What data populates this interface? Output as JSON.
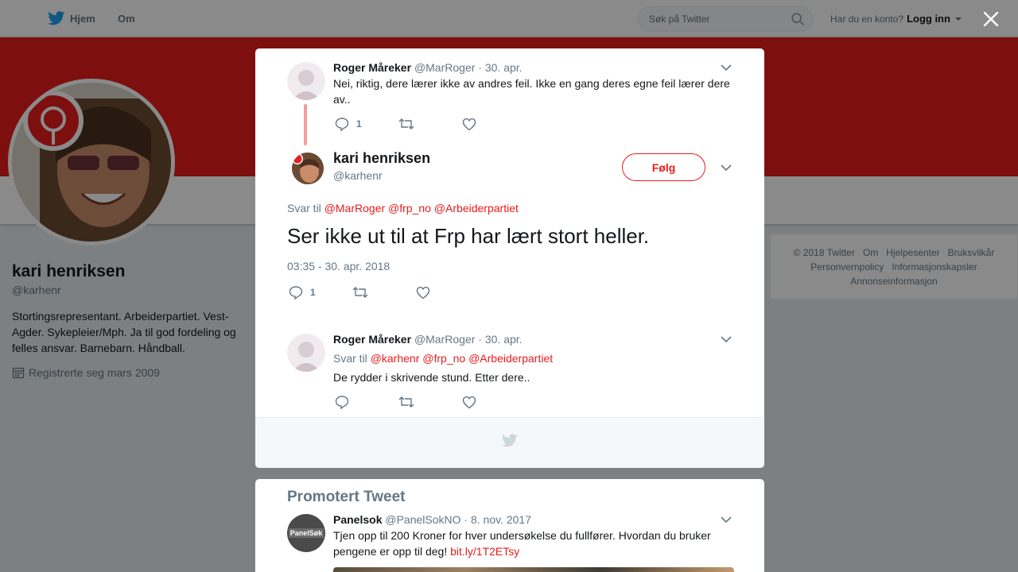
{
  "topbar": {
    "home_label": "Hjem",
    "about_label": "Om",
    "search_placeholder": "Søk på Twitter",
    "account_question": "Har du en konto?",
    "login_label": "Logg inn"
  },
  "profile": {
    "name": "kari henriksen",
    "handle": "@karhenr",
    "bio": "Stortingsrepresentant. Arbeiderpartiet. Vest-Agder. Sykepleier/Mph. Ja til god fordeling og felles ansvar. Barnebarn. Håndball.",
    "joined": "Registrerte seg mars 2009"
  },
  "footer_links": [
    "© 2018 Twitter",
    "Om",
    "Hjelpesenter",
    "Bruksvilkår",
    "Personvernpolicy",
    "Informasjonskapsler",
    "Annonseinformasjon"
  ],
  "modal": {
    "parent_tweet": {
      "name": "Roger Måreker",
      "handle": "@MarRoger",
      "date": "30. apr.",
      "text": "Nei, riktig, dere lærer ikke av andres feil. Ikke en gang deres egne feil lærer dere av..",
      "reply_count": "1"
    },
    "main_tweet": {
      "name": "kari henriksen",
      "handle": "@karhenr",
      "follow_label": "Følg",
      "reply_prefix": "Svar til",
      "reply_mentions": [
        "@MarRoger",
        "@frp_no",
        "@Arbeiderpartiet"
      ],
      "text": "Ser ikke ut til at Frp har lært stort heller.",
      "timestamp": "03:35 - 30. apr. 2018",
      "reply_count": "1"
    },
    "reply_tweet": {
      "name": "Roger Måreker",
      "handle": "@MarRoger",
      "date": "30. apr.",
      "reply_prefix": "Svar til",
      "reply_mentions": [
        "@karhenr",
        "@frp_no",
        "@Arbeiderpartiet"
      ],
      "text": "De rydder i skrivende stund. Etter dere.."
    }
  },
  "promo": {
    "title": "Promotert Tweet",
    "name": "Panelsok",
    "handle": "@PanelSokNO",
    "date": "8. nov. 2017",
    "text": "Tjen opp til 200 Kroner for hver undersøkelse du fullfører. Hvordan du bruker pengene er opp til deg!",
    "link": "bit.ly/1T2ETsy",
    "avatar_text": "PanelSøk"
  },
  "colors": {
    "accent": "#e81c1c",
    "cover": "#e81c1c",
    "muted": "#657786",
    "twitter_blue": "#1da1f2"
  }
}
